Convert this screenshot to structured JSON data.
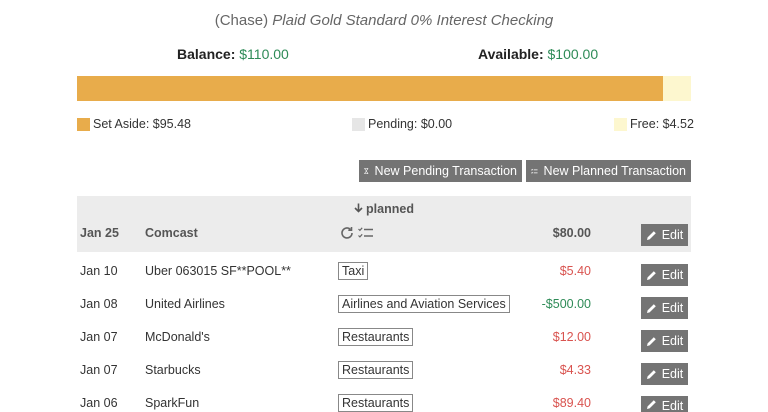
{
  "account": {
    "bank": "(Chase)",
    "name": "Plaid Gold Standard 0% Interest Checking",
    "balance_label": "Balance:",
    "balance_value": "$110.00",
    "available_label": "Available:",
    "available_value": "$100.00"
  },
  "allocation": {
    "set_aside_fraction": 0.9549,
    "pending_fraction": 0.0,
    "free_fraction": 0.0451,
    "colors": {
      "set_aside": "#e8ac4b",
      "pending": "#e6e6e6",
      "free": "#fdf7cf"
    }
  },
  "legend": {
    "set_aside": "Set Aside: $95.48",
    "pending": "Pending: $0.00",
    "free": "Free: $4.52"
  },
  "actions": {
    "new_pending": "New Pending Transaction",
    "new_planned": "New Planned Transaction"
  },
  "planned_section": {
    "label": "planned",
    "row": {
      "date": "Jan 25",
      "payee": "Comcast",
      "amount": "$80.00",
      "edit": "Edit"
    }
  },
  "transactions": [
    {
      "date": "Jan 10",
      "payee": "Uber 063015 SF**POOL**",
      "category": "Taxi",
      "amount": "$5.40",
      "amount_color": "#d9534f",
      "edit": "Edit"
    },
    {
      "date": "Jan 08",
      "payee": "United Airlines",
      "category": "Airlines and Aviation Services",
      "amount": "-$500.00",
      "amount_color": "#2e8b57",
      "edit": "Edit"
    },
    {
      "date": "Jan 07",
      "payee": "McDonald's",
      "category": "Restaurants",
      "amount": "$12.00",
      "amount_color": "#d9534f",
      "edit": "Edit"
    },
    {
      "date": "Jan 07",
      "payee": "Starbucks",
      "category": "Restaurants",
      "amount": "$4.33",
      "amount_color": "#d9534f",
      "edit": "Edit"
    },
    {
      "date": "Jan 06",
      "payee": "SparkFun",
      "category": "Restaurants",
      "amount": "$89.40",
      "amount_color": "#d9534f",
      "edit": "Edit"
    }
  ]
}
